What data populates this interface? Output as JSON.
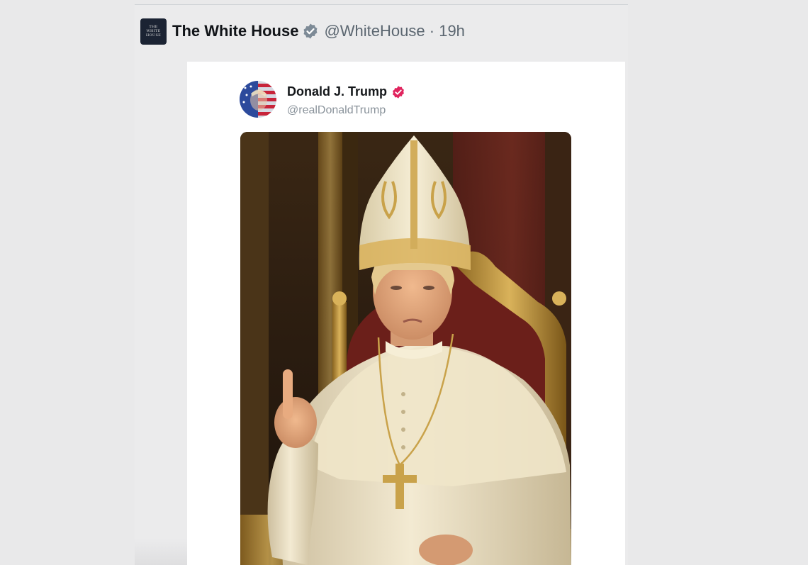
{
  "tweet": {
    "account_name": "The White House",
    "handle": "@WhiteHouse",
    "separator": "·",
    "time_ago": "19h",
    "avatar_text": [
      "THE",
      "WHITE",
      "HOUSE"
    ],
    "verified_icon": "verified-badge-gray-icon"
  },
  "quoted_post": {
    "author_name": "Donald J. Trump",
    "author_handle": "@realDonaldTrump",
    "verified_icon": "verified-badge-pink-icon",
    "image_subject": "portrait-in-papal-vestments"
  },
  "colors": {
    "page_bg": "#e9e9ea",
    "card_bg": "#ffffff",
    "name_text": "#111418",
    "meta_text": "#5b6670",
    "verified_gray": "#7d8a96",
    "verified_pink": "#e0245e"
  }
}
